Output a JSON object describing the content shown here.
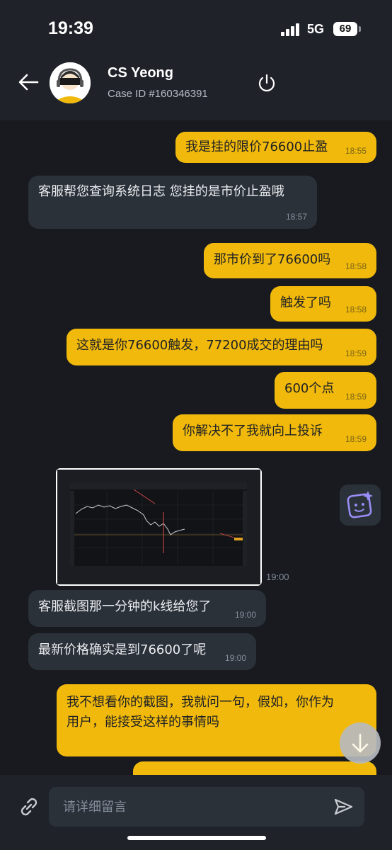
{
  "status_bar": {
    "time": "19:39",
    "network": "5G",
    "battery": "69"
  },
  "header": {
    "title": "CS Yeong",
    "case_id": "Case ID #160346391"
  },
  "messages": [
    {
      "dir": "out",
      "text": "我是挂的限价76600止盈",
      "time": "18:55"
    },
    {
      "dir": "in",
      "text": "客服帮您查询系统日志 您挂的是市价止盈哦",
      "time": "18:57"
    },
    {
      "dir": "out",
      "text": "那市价到了76600吗",
      "time": "18:58"
    },
    {
      "dir": "out",
      "text": "触发了吗",
      "time": "18:58"
    },
    {
      "dir": "out",
      "text": "这就是你76600触发，77200成交的理由吗",
      "time": "18:59"
    },
    {
      "dir": "out",
      "text": "600个点",
      "time": "18:59"
    },
    {
      "dir": "out",
      "text": "你解决不了我就向上投诉",
      "time": "18:59"
    },
    {
      "dir": "in",
      "type": "image",
      "time": "19:00"
    },
    {
      "dir": "in",
      "text": "客服截图那一分钟的k线给您了",
      "time": "19:00"
    },
    {
      "dir": "in",
      "text": "最新价格确实是到76600了呢",
      "time": "19:00"
    },
    {
      "dir": "out",
      "text_line1": "我不想看你的截图，我就问一句，假如，你作为",
      "text_line2": "用户，能接受这样的事情吗"
    }
  ],
  "composer": {
    "placeholder": "请详细留言"
  },
  "colors": {
    "accent": "#f0b90b",
    "background": "#181a20",
    "bubble_in": "#2b3139"
  },
  "icons": [
    "back-arrow-icon",
    "power-icon",
    "ai-assistant-icon",
    "scroll-down-icon",
    "attach-link-icon",
    "send-icon"
  ]
}
